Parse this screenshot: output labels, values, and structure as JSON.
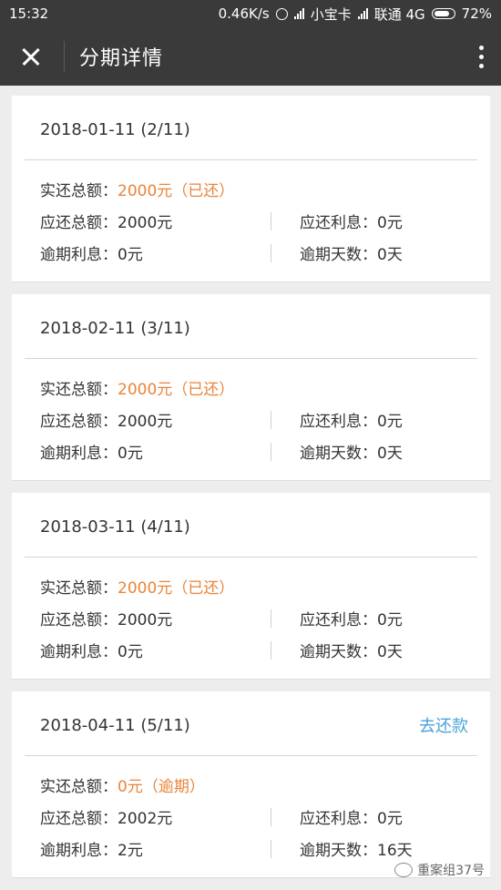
{
  "status": {
    "time": "15:32",
    "speed": "0.46K/s",
    "sim1": "小宝卡",
    "sim2": "联通 4G",
    "battery": "72%"
  },
  "nav": {
    "title": "分期详情"
  },
  "labels": {
    "actual_total": "实还总额：",
    "due_total": "应还总额：",
    "due_interest": "应还利息：",
    "overdue_interest": "逾期利息：",
    "overdue_days": "逾期天数："
  },
  "installments": [
    {
      "date": "2018-01-11 (2/11)",
      "actual_total": "2000元（已还）",
      "due_total": "2000元",
      "due_interest": "0元",
      "overdue_interest": "0元",
      "overdue_days": "0天"
    },
    {
      "date": "2018-02-11 (3/11)",
      "actual_total": "2000元（已还）",
      "due_total": "2000元",
      "due_interest": "0元",
      "overdue_interest": "0元",
      "overdue_days": "0天"
    },
    {
      "date": "2018-03-11 (4/11)",
      "actual_total": "2000元（已还）",
      "due_total": "2000元",
      "due_interest": "0元",
      "overdue_interest": "0元",
      "overdue_days": "0天"
    },
    {
      "date": "2018-04-11 (5/11)",
      "action": "去还款",
      "actual_total": "0元（逾期）",
      "due_total": "2002元",
      "due_interest": "0元",
      "overdue_interest": "2元",
      "overdue_days": "16天"
    }
  ],
  "watermark": "重案组37号",
  "colors": {
    "accent": "#e8843a",
    "link": "#4aa3d8",
    "bar": "#3a3a3a"
  }
}
